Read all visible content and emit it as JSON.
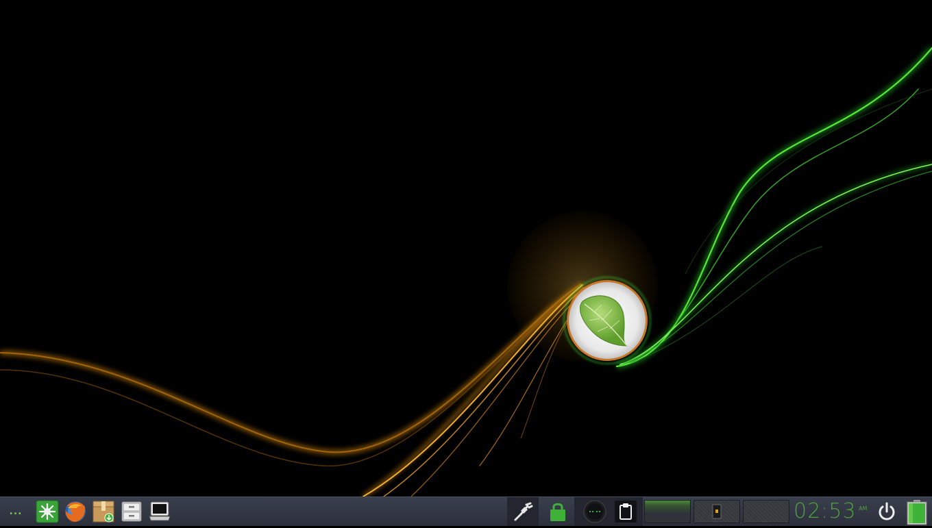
{
  "desktop": {
    "wallpaper_icon": "leaf-orb-logo"
  },
  "taskbar": {
    "menu": {
      "label": "...",
      "icon": "app-menu-icon"
    },
    "launchers": [
      {
        "icon": "system-tools-icon",
        "color": "#3aa33a"
      },
      {
        "icon": "firefox-icon",
        "color": "#e56b1f"
      },
      {
        "icon": "package-installer-icon",
        "color": "#c79a5a"
      },
      {
        "icon": "file-cabinet-icon",
        "color": "#d9d9d9"
      },
      {
        "icon": "terminal-icon",
        "color": "#e8e8e8"
      }
    ],
    "tray": [
      {
        "icon": "network-plug-icon"
      },
      {
        "icon": "lock-icon",
        "color": "#3fb23a"
      },
      {
        "icon": "volume-knob-icon"
      },
      {
        "icon": "clipboard-icon"
      }
    ],
    "workspaces": [
      {
        "icon": "workspace-1",
        "active": true
      },
      {
        "icon": "workspace-2",
        "active": false
      },
      {
        "icon": "workspace-3",
        "active": false
      }
    ],
    "clock": {
      "time": "02:53",
      "ampm": "AM",
      "color": "#4ea23a"
    },
    "power_icon": "power-icon",
    "battery_icon": "battery-icon"
  }
}
